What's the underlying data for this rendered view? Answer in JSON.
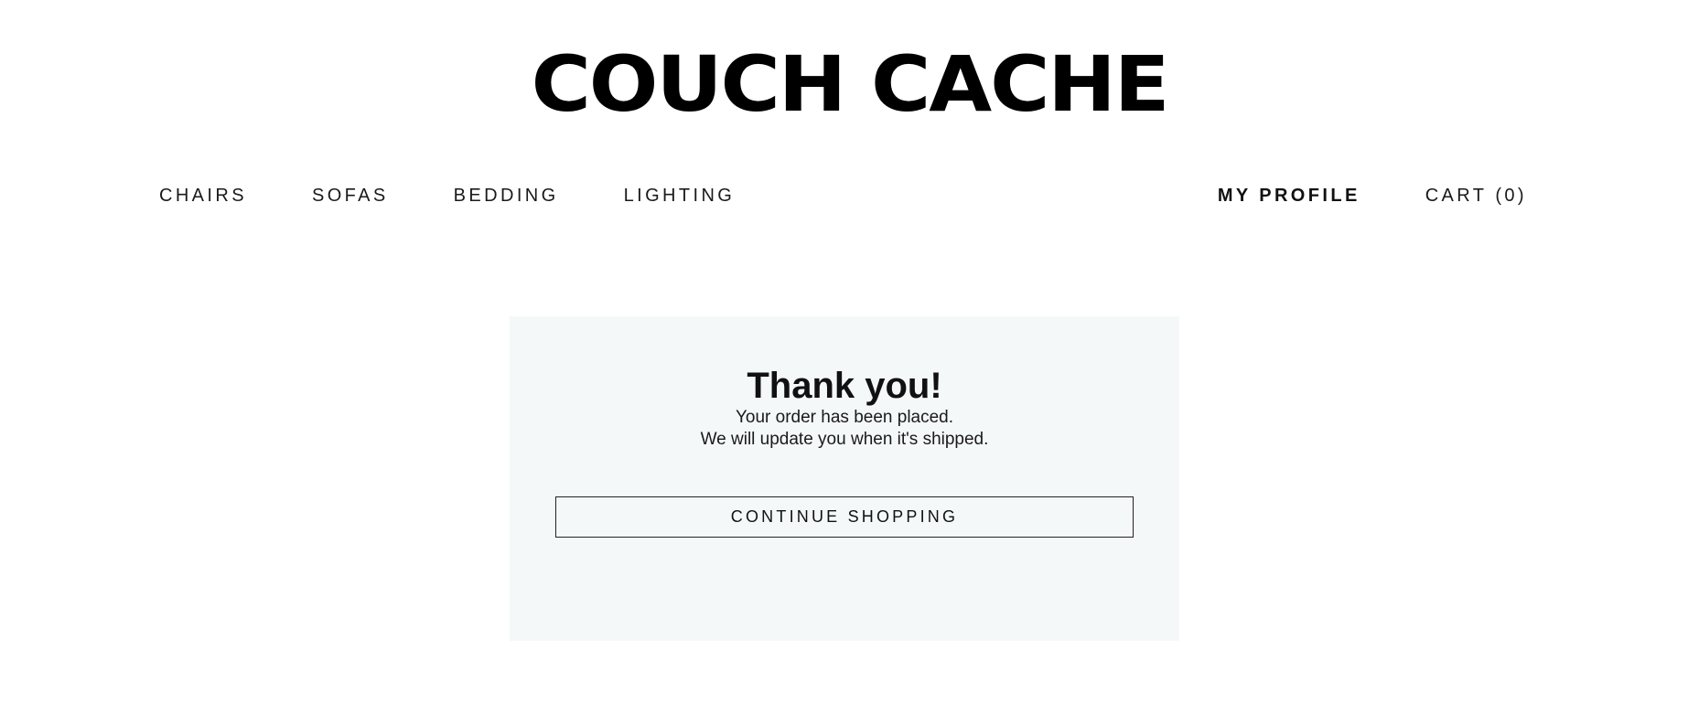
{
  "header": {
    "logo_text": "COUCH CACHE"
  },
  "nav": {
    "left_items": [
      {
        "label": "CHAIRS"
      },
      {
        "label": "SOFAS"
      },
      {
        "label": "BEDDING"
      },
      {
        "label": "LIGHTING"
      }
    ],
    "profile_label": "MY PROFILE",
    "cart_label": "CART",
    "cart_count": "(0)"
  },
  "confirmation": {
    "title": "Thank you!",
    "line_1": "Your order has been placed.",
    "line_2": "We will update you when it's shipped.",
    "button_label": "CONTINUE SHOPPING"
  },
  "colors": {
    "panel_background": "#f5f8f9",
    "text": "#111111",
    "border": "#222222"
  }
}
